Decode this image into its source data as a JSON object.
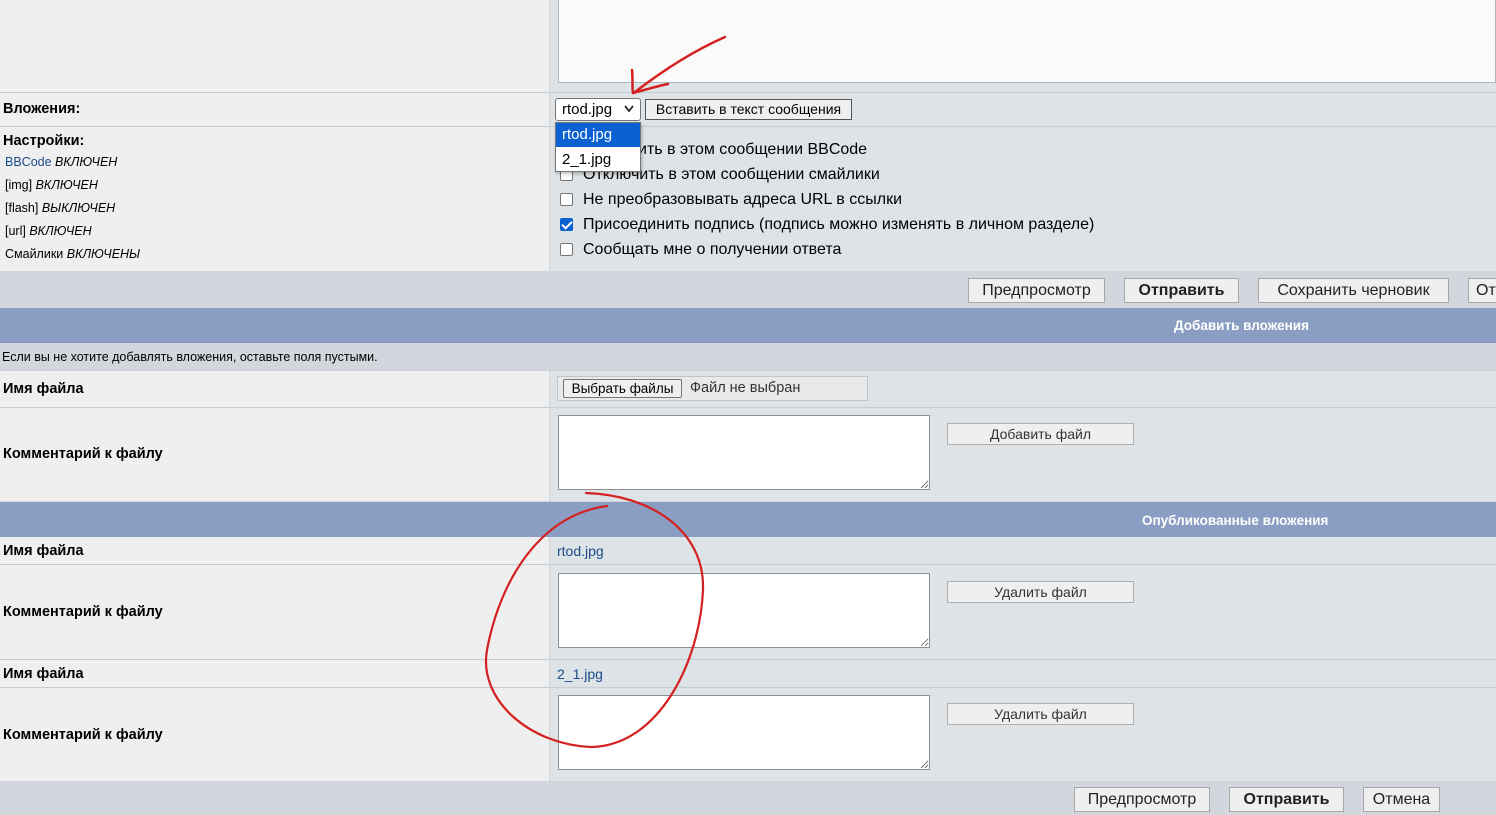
{
  "attachments_row": {
    "label": "Вложения:",
    "selected": "rtod.jpg",
    "insert_button": "Вставить в текст сообщения",
    "dropdown_options": [
      "rtod.jpg",
      "2_1.jpg"
    ]
  },
  "settings": {
    "label": "Настройки:",
    "items": [
      {
        "name": "BBCode",
        "state": "ВКЛЮЧЕН"
      },
      {
        "name": "[img]",
        "state": "ВКЛЮЧЕН"
      },
      {
        "name": "[flash]",
        "state": "ВЫКЛЮЧЕН"
      },
      {
        "name": "[url]",
        "state": "ВКЛЮЧЕН"
      },
      {
        "name": "Смайлики",
        "state": "ВКЛЮЧЕНЫ"
      }
    ],
    "options": [
      {
        "label": "ить в этом сообщении BBCode",
        "checked": false
      },
      {
        "label": "Отключить в этом сообщении смайлики",
        "checked": false
      },
      {
        "label": "Не преобразовывать адреса URL в ссылки",
        "checked": false
      },
      {
        "label": "Присоединить подпись (подпись можно изменять в личном разделе)",
        "checked": true
      },
      {
        "label": "Сообщать мне о получении ответа",
        "checked": false
      }
    ]
  },
  "top_buttons": {
    "preview": "Предпросмотр",
    "submit": "Отправить",
    "save_draft": "Сохранить черновик",
    "cancel_partial": "От"
  },
  "add_attachments": {
    "title": "Добавить вложения",
    "hint": "Если вы не хотите добавлять вложения, оставьте поля пустыми.",
    "filename_label": "Имя файла",
    "choose_button": "Выбрать файлы",
    "no_file": "Файл не выбран",
    "comment_label": "Комментарий к файлу",
    "add_button": "Добавить файл"
  },
  "posted_attachments": {
    "title": "Опубликованные вложения",
    "items": [
      {
        "filename_label": "Имя файла",
        "filename": "rtod.jpg",
        "comment_label": "Комментарий к файлу",
        "delete_button": "Удалить файл"
      },
      {
        "filename_label": "Имя файла",
        "filename": "2_1.jpg",
        "comment_label": "Комментарий к файлу",
        "delete_button": "Удалить файл"
      }
    ]
  },
  "bottom_buttons": {
    "preview": "Предпросмотр",
    "submit": "Отправить",
    "cancel": "Отмена"
  },
  "colors": {
    "category_bar": "#8a9dc2",
    "link": "#1a4b8a",
    "annotation": "#d42020",
    "selected_option": "#0b61d2"
  }
}
